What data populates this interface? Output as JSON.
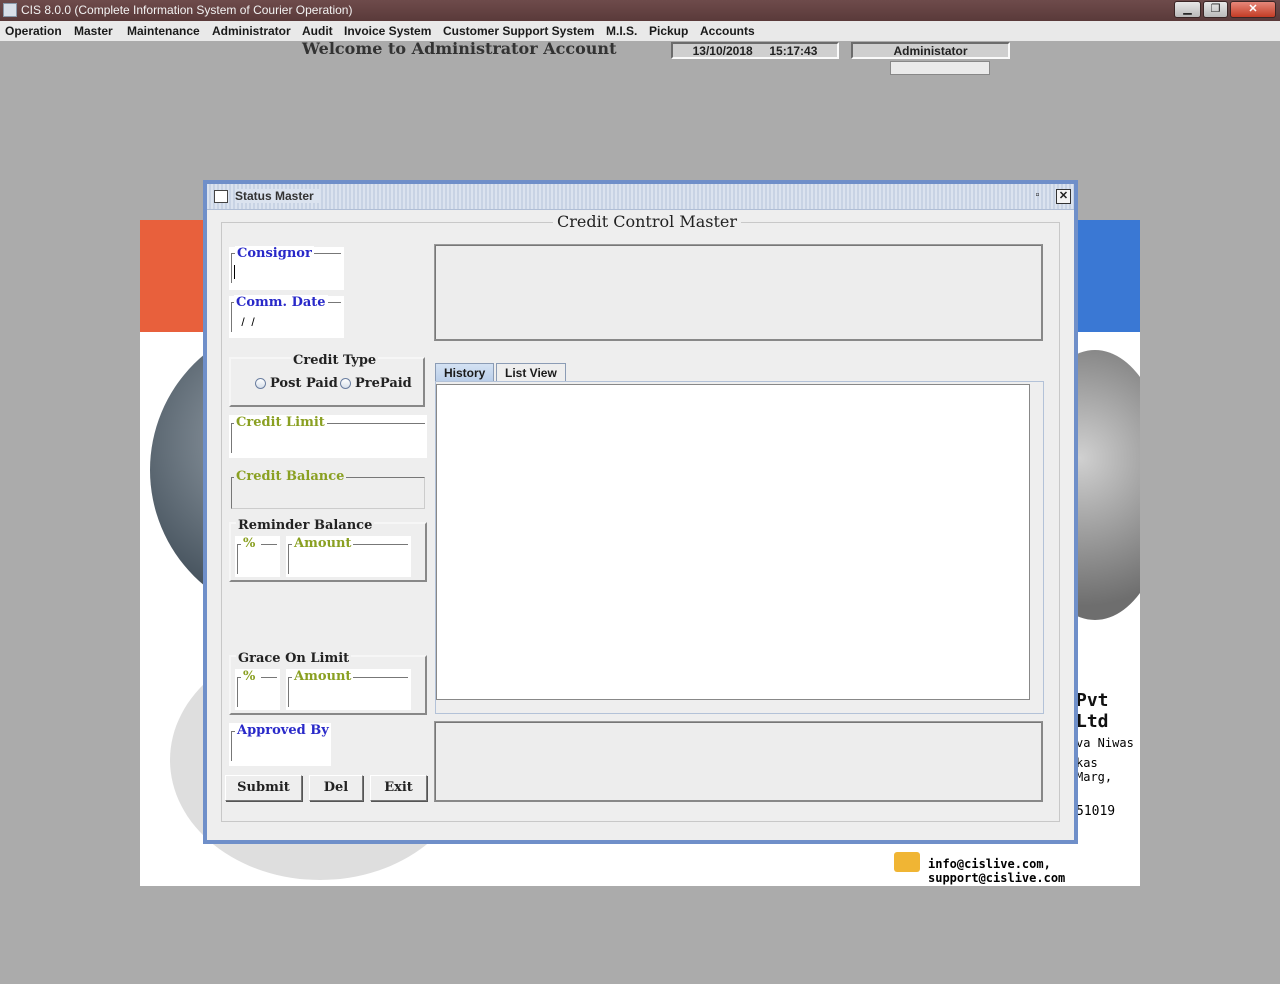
{
  "window": {
    "title": "CIS 8.0.0 (Complete Information System of Courier Operation)",
    "controls": {
      "minimize": "▁",
      "maximize": "❐",
      "close": "✕"
    }
  },
  "menu": [
    "Operation",
    "Master",
    "Maintenance",
    "Administrator",
    "Audit",
    "Invoice System",
    "Customer Support System",
    "M.I.S.",
    "Pickup",
    "Accounts"
  ],
  "header": {
    "welcome": "Welcome to Administrator Account",
    "date": "13/10/2018",
    "time": "15:17:43",
    "user": "Administator"
  },
  "banner": {
    "company": "Pvt Ltd",
    "address1": "va Niwas",
    "address2": "kas Marg,",
    "phone": "51019",
    "email": "info@cislive.com, support@cislive.com"
  },
  "frame": {
    "title": "Status Master",
    "restore": "▫",
    "close": "✕",
    "group_title": "Credit Control Master"
  },
  "form": {
    "consignor_label": "Consignor",
    "consignor_value": "",
    "comm_date_label": "Comm. Date",
    "comm_date_value": " /  /",
    "credit_type_label": "Credit Type",
    "post_paid": "Post Paid",
    "prepaid": "PrePaid",
    "credit_limit_label": "Credit Limit",
    "credit_balance_label": "Credit Balance",
    "reminder_balance_label": "Reminder Balance",
    "reminder_pct_label": "%",
    "reminder_amount_label": "Amount",
    "grace_label": "Grace On Limit",
    "grace_pct_label": "%",
    "grace_amount_label": "Amount",
    "approved_by_label": "Approved By",
    "tabs": [
      "History",
      "List View"
    ],
    "buttons": {
      "submit": "Submit",
      "del": "Del",
      "exit": "Exit"
    }
  }
}
